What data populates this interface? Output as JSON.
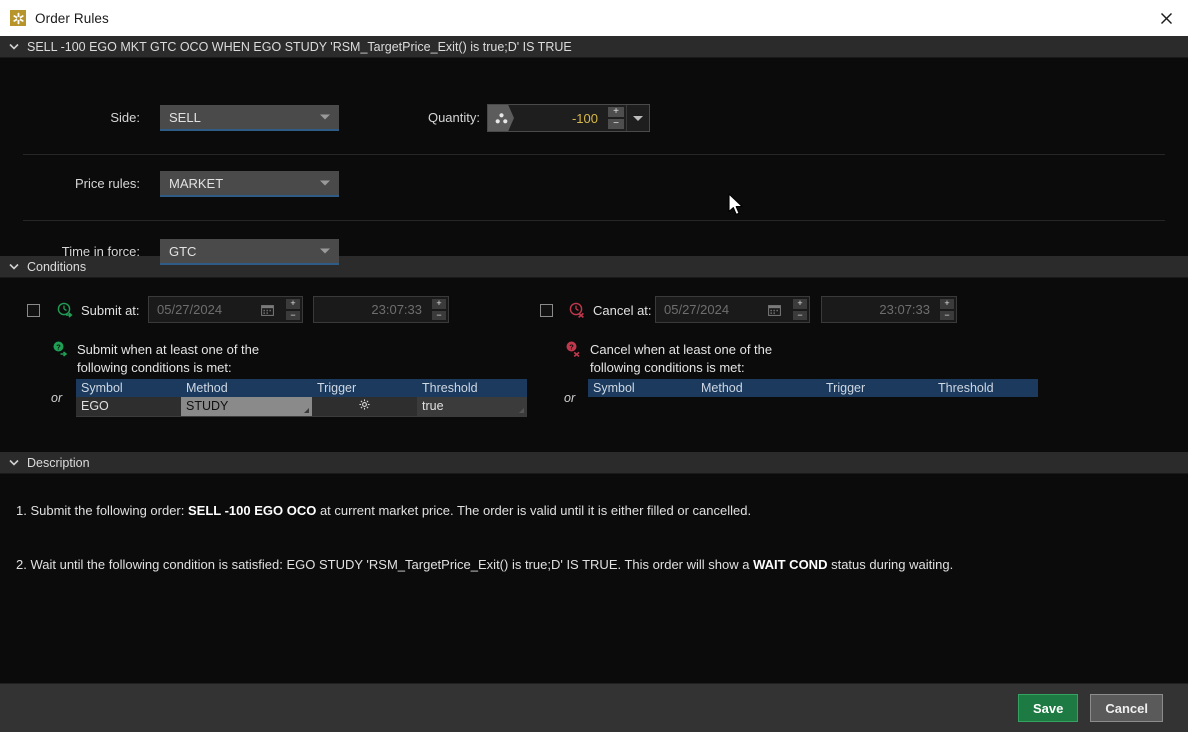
{
  "window": {
    "title": "Order Rules",
    "app_icon": "asterisk-flower-icon",
    "close_icon": "close-icon",
    "accent_blue": "#2f5c86",
    "header_gray": "#2b2b2b",
    "background": "#0b0b0b"
  },
  "order_summary": {
    "chevron": "chevron-down-icon",
    "text": "SELL -100 EGO MKT GTC OCO WHEN EGO STUDY 'RSM_TargetPrice_Exit() is true;D' IS TRUE"
  },
  "fields": {
    "side": {
      "label": "Side:",
      "value": "SELL"
    },
    "quantity": {
      "label": "Quantity:",
      "value": "-100",
      "value_color": "#d9b84a",
      "icon": "order-type-icon",
      "increment_label": "+",
      "decrement_label": "−",
      "dropdown_icon": "chevron-down-icon"
    },
    "price_rules": {
      "label": "Price rules:",
      "value": "MARKET"
    },
    "time_in_force": {
      "label": "Time in force:",
      "value": "GTC"
    }
  },
  "conditions": {
    "section_title": "Conditions",
    "chevron": "chevron-down-icon",
    "submit": {
      "checkbox_checked": false,
      "clock_icon": "clock-submit-icon",
      "clock_color": "#1f9e54",
      "label": "Submit at:",
      "date_value": "05/27/2024",
      "date_icon": "calendar-icon",
      "time_value": "23:07:33",
      "increment_label": "+",
      "decrement_label": "−",
      "condition_icon": "question-submit-icon",
      "condition_text_line1": "Submit when at least one of the",
      "condition_text_line2": "following conditions is met:",
      "or_label": "or",
      "columns": [
        "Symbol",
        "Method",
        "Trigger",
        "Threshold"
      ],
      "rows": [
        {
          "symbol": "EGO",
          "method": "STUDY",
          "gear_icon": "gear-icon",
          "trigger": "true",
          "threshold": ""
        }
      ]
    },
    "cancel": {
      "checkbox_checked": false,
      "clock_icon": "clock-cancel-icon",
      "clock_color": "#c0384b",
      "label": "Cancel at:",
      "date_value": "05/27/2024",
      "date_icon": "calendar-icon",
      "time_value": "23:07:33",
      "increment_label": "+",
      "decrement_label": "−",
      "condition_icon": "question-cancel-icon",
      "condition_text_line1": "Cancel when at least one of the",
      "condition_text_line2": "following conditions is met:",
      "or_label": "or",
      "columns": [
        "Symbol",
        "Method",
        "Trigger",
        "Threshold"
      ],
      "rows": []
    }
  },
  "description": {
    "section_title": "Description",
    "chevron": "chevron-down-icon",
    "item1": {
      "prefix": "1. Submit the following order: ",
      "bold": "SELL -100 EGO OCO",
      "suffix": " at current market price. The order is valid until it is either filled or cancelled."
    },
    "item2": {
      "prefix": "2. Wait until the following condition is satisfied: EGO STUDY 'RSM_TargetPrice_Exit() is true;D' IS TRUE. This order will show a ",
      "bold": "WAIT COND",
      "suffix": " status during waiting."
    }
  },
  "footer": {
    "save_label": "Save",
    "cancel_label": "Cancel",
    "save_color": "#1d7a42"
  }
}
